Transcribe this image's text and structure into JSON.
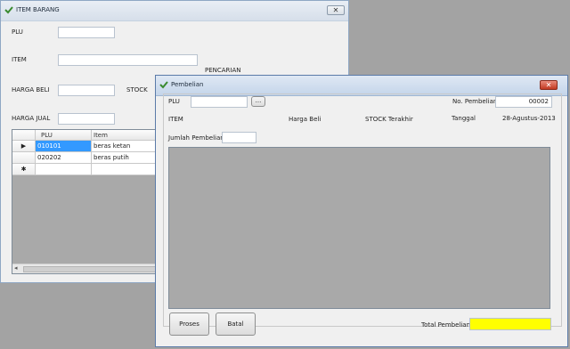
{
  "back_window": {
    "title": "ITEM BARANG",
    "labels": {
      "plu": "PLU",
      "item": "ITEM",
      "harga_beli": "HARGA BELI",
      "stock": "STOCK",
      "harga_jual": "HARGA JUAL",
      "pencarian": "PENCARIAN"
    },
    "grid": {
      "columns": [
        "PLU",
        "Item"
      ],
      "rows": [
        {
          "plu": "010101",
          "item": "beras ketan"
        },
        {
          "plu": "020202",
          "item": "beras putih"
        }
      ],
      "row_indicator": "▶",
      "new_row_indicator": "✱"
    }
  },
  "front_window": {
    "title": "Pembelian",
    "plu_label": "PLU",
    "browse_label": "...",
    "no_pembelian_label": "No. Pembelian",
    "no_pembelian_value": "00002",
    "item_label": "ITEM",
    "harga_beli_label": "Harga Beli",
    "stock_label": "STOCK Terakhir",
    "tanggal_label": "Tanggal",
    "tanggal_value": "28-Agustus-2013",
    "jumlah_label": "Jumlah Pembelian",
    "proses_label": "Proses",
    "batal_label": "Batal",
    "total_label": "Total Pembelian",
    "total_value": ""
  },
  "colors": {
    "accent_selection": "#3399ff",
    "total_field": "#ffff00",
    "close_red": "#c23a22"
  }
}
